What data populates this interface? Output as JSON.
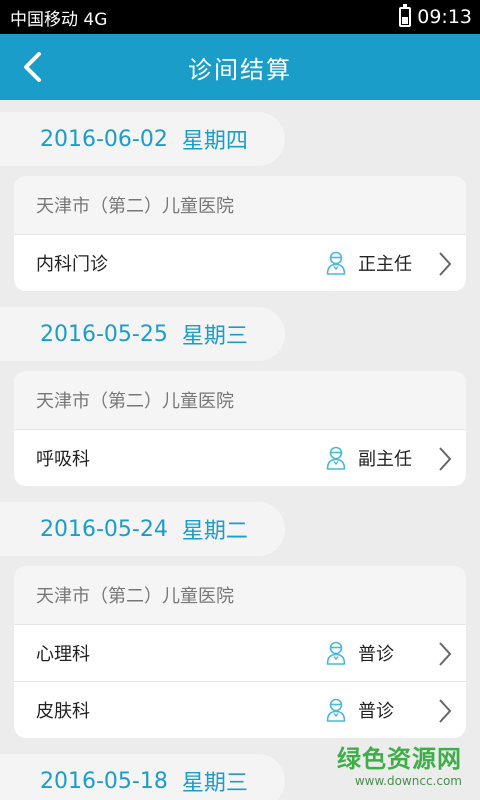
{
  "status": {
    "carrier": "中国移动 4G",
    "time": "09:13"
  },
  "nav": {
    "title": "诊间结算"
  },
  "groups": [
    {
      "date": "2016-06-02",
      "weekday": "星期四",
      "hospital": "天津市（第二）儿童医院",
      "rows": [
        {
          "dept": "内科门诊",
          "doctor": "正主任"
        }
      ]
    },
    {
      "date": "2016-05-25",
      "weekday": "星期三",
      "hospital": "天津市（第二）儿童医院",
      "rows": [
        {
          "dept": "呼吸科",
          "doctor": "副主任"
        }
      ]
    },
    {
      "date": "2016-05-24",
      "weekday": "星期二",
      "hospital": "天津市（第二）儿童医院",
      "rows": [
        {
          "dept": "心理科",
          "doctor": "普诊"
        },
        {
          "dept": "皮肤科",
          "doctor": "普诊"
        }
      ]
    },
    {
      "date": "2016-05-18",
      "weekday": "星期三"
    }
  ],
  "watermark": {
    "main": "绿色资源网",
    "sub": "www.downcc.com"
  },
  "colors": {
    "accent": "#1a9ec9",
    "icon": "#4bb8d6"
  },
  "icons": {
    "back": "chevron-left-icon",
    "doctor": "doctor-icon",
    "row_arrow": "chevron-right-icon",
    "battery": "battery-icon"
  }
}
